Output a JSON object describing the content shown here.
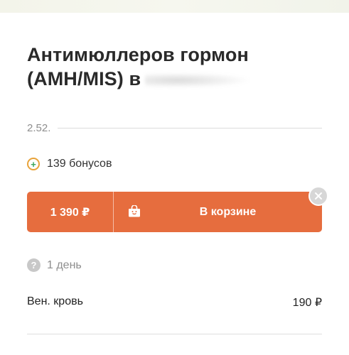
{
  "product": {
    "title_line1": "Антимюллеров гормон",
    "title_line2": "(AMH/MIS) в",
    "code": "2.52."
  },
  "bonus": {
    "icon": "plus-circle-icon",
    "text": "139 бонусов"
  },
  "cart": {
    "price": "1 390 ₽",
    "label": "В корзине",
    "bag_icon": "shopping-bag-icon",
    "remove_icon": "close-icon",
    "accent_color": "#e66d3e"
  },
  "term": {
    "icon": "question-icon",
    "help_glyph": "?",
    "text": "1 день"
  },
  "material": {
    "name": "Вен. кровь",
    "price": "190 ₽"
  }
}
